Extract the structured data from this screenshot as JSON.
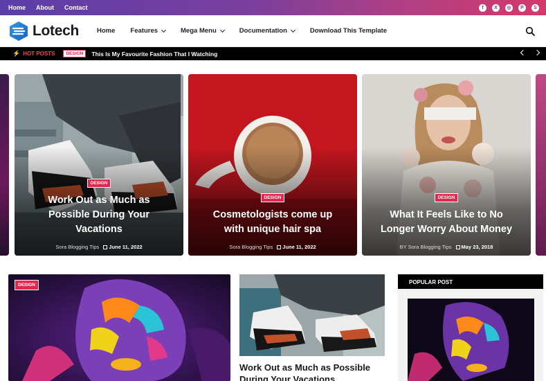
{
  "topbar": {
    "links": [
      "Home",
      "About",
      "Contact"
    ],
    "social_icons": [
      "facebook-icon",
      "x-twitter-icon",
      "instagram-icon",
      "pinterest-icon",
      "skype-icon"
    ]
  },
  "header": {
    "logo_text": "Lotech",
    "nav": [
      {
        "label": "Home",
        "has_dropdown": false
      },
      {
        "label": "Features",
        "has_dropdown": true
      },
      {
        "label": "Mega Menu",
        "has_dropdown": true
      },
      {
        "label": "Documentation",
        "has_dropdown": true
      },
      {
        "label": "Download This Template",
        "has_dropdown": false
      }
    ],
    "search_icon": "search-icon"
  },
  "ticker": {
    "label": "HOT POSTS",
    "tag": "DESIGN",
    "title": "This Is My Favourite Fashion That I Watching"
  },
  "slider": [
    {
      "tag": "DESIGN",
      "title": "Work Out as Much as Possible During Your Vacations",
      "author": "Sora Blogging Tips",
      "date": "June 11, 2022"
    },
    {
      "tag": "DESIGN",
      "title": "Cosmetologists come up with unique hair spa",
      "author": "Sora Blogging Tips",
      "date": "June 11, 2022"
    },
    {
      "tag": "DESIGN",
      "title": "What It Feels Like to No Longer Worry About Money",
      "author_prefix": "BY",
      "author": "Sora Blogging Tips",
      "date": "May 23, 2018"
    }
  ],
  "main": {
    "big_tag": "DESIGN",
    "mid_title": "Work Out as Much as Possible During Your Vacations"
  },
  "sidebar": {
    "heading": "POPULAR POST"
  },
  "colors": {
    "accent": "#e2264d",
    "topbar_start": "#5a3ea8",
    "topbar_end": "#d23a6a"
  }
}
